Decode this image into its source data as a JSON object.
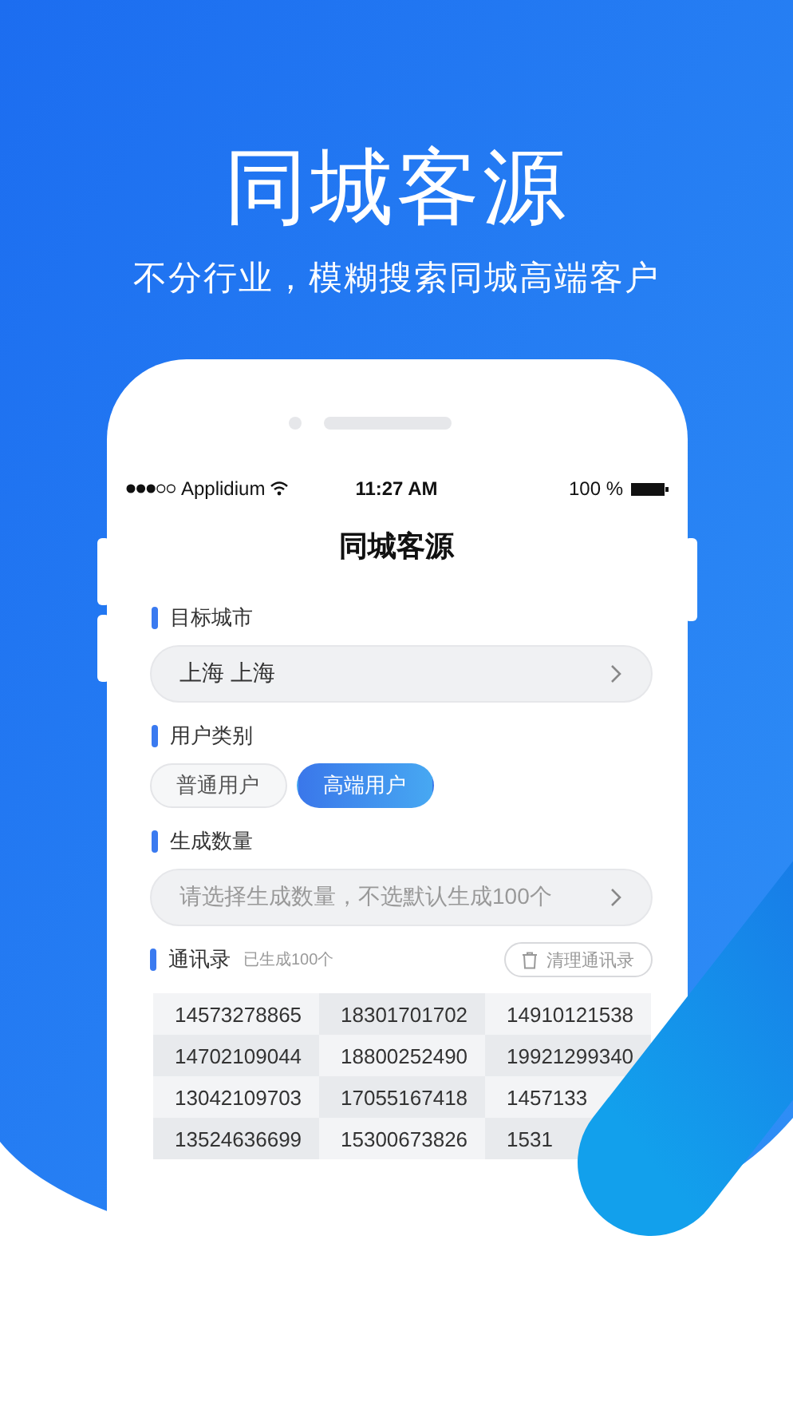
{
  "header": {
    "title": "同城客源",
    "subtitle": "不分行业，模糊搜索同城高端客户"
  },
  "status_bar": {
    "carrier": "Applidium",
    "time": "11:27 AM",
    "battery": "100 %"
  },
  "screen_title": "同城客源",
  "target_city": {
    "label": "目标城市",
    "value": "上海 上海"
  },
  "user_type": {
    "label": "用户类别",
    "options": [
      {
        "label": "普通用户",
        "selected": false
      },
      {
        "label": "高端用户",
        "selected": true
      }
    ]
  },
  "quantity": {
    "label": "生成数量",
    "placeholder": "请选择生成数量，不选默认生成100个"
  },
  "contacts": {
    "label": "通讯录",
    "count_note": "已生成100个",
    "clear_button": "清理通讯录",
    "rows": [
      [
        "14573278865",
        "18301701702",
        "14910121538"
      ],
      [
        "14702109044",
        "18800252490",
        "19921299340"
      ],
      [
        "13042109703",
        "17055167418",
        "1457133"
      ],
      [
        "13524636699",
        "15300673826",
        "1531"
      ]
    ]
  }
}
